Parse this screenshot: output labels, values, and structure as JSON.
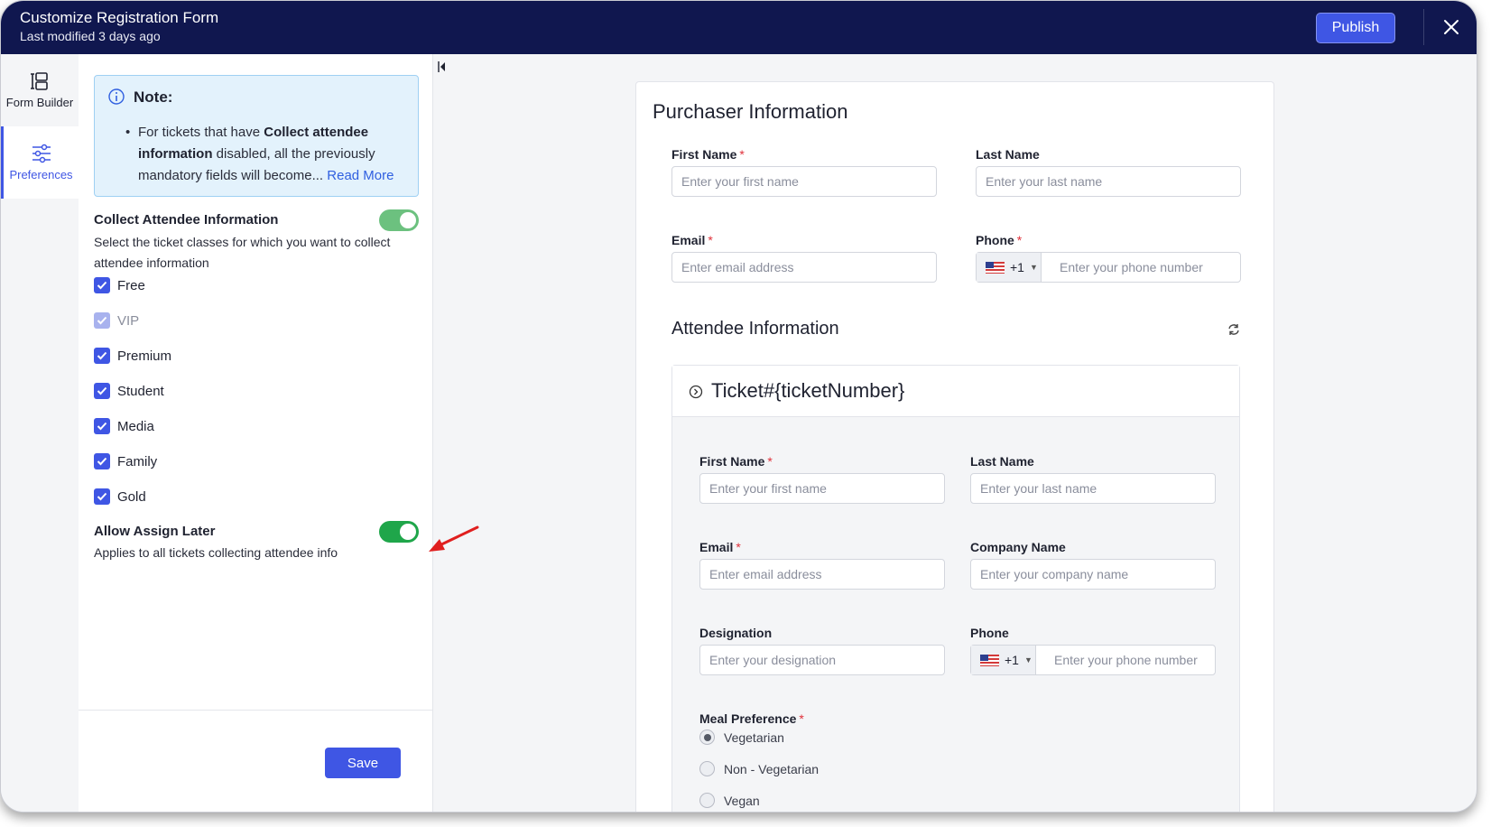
{
  "header": {
    "title": "Customize Registration Form",
    "subtitle": "Last modified 3 days ago",
    "publish_label": "Publish"
  },
  "rail": {
    "items": [
      {
        "label": "Form Builder",
        "icon": "form-builder-icon"
      },
      {
        "label": "Preferences",
        "icon": "sliders-icon",
        "active": true
      }
    ]
  },
  "note": {
    "title": "Note:",
    "text_prefix": "For tickets that have ",
    "text_bold": "Collect attendee information",
    "text_suffix": " disabled, all the previously mandatory fields will become...",
    "read_more": "Read More"
  },
  "collect_attendee": {
    "title": "Collect Attendee Information",
    "description": "Select the ticket classes for which you want to collect attendee information",
    "enabled": true,
    "ticket_classes": [
      {
        "label": "Free",
        "checked": true,
        "disabled": false
      },
      {
        "label": "VIP",
        "checked": true,
        "disabled": true
      },
      {
        "label": "Premium",
        "checked": true,
        "disabled": false
      },
      {
        "label": "Student",
        "checked": true,
        "disabled": false
      },
      {
        "label": "Media",
        "checked": true,
        "disabled": false
      },
      {
        "label": "Family",
        "checked": true,
        "disabled": false
      },
      {
        "label": "Gold",
        "checked": true,
        "disabled": false
      }
    ]
  },
  "assign_later": {
    "title": "Allow Assign Later",
    "description": "Applies to all tickets collecting attendee info",
    "enabled": true
  },
  "save_label": "Save",
  "purchaser": {
    "heading": "Purchaser Information",
    "first_name_label": "First Name",
    "first_name_placeholder": "Enter your first name",
    "last_name_label": "Last Name",
    "last_name_placeholder": "Enter your last name",
    "email_label": "Email",
    "email_placeholder": "Enter email address",
    "phone_label": "Phone",
    "phone_code": "+1",
    "phone_placeholder": "Enter your phone number"
  },
  "attendee": {
    "heading": "Attendee Information",
    "ticket_title": "Ticket#{ticketNumber}",
    "first_name_label": "First Name",
    "first_name_placeholder": "Enter your first name",
    "last_name_label": "Last Name",
    "last_name_placeholder": "Enter your last name",
    "email_label": "Email",
    "email_placeholder": "Enter email address",
    "company_label": "Company Name",
    "company_placeholder": "Enter your company name",
    "designation_label": "Designation",
    "designation_placeholder": "Enter your designation",
    "phone_label": "Phone",
    "phone_code": "+1",
    "phone_placeholder": "Enter your phone number",
    "meal_label": "Meal Preference",
    "meal_options": [
      {
        "label": "Vegetarian",
        "selected": true
      },
      {
        "label": "Non - Vegetarian",
        "selected": false
      },
      {
        "label": "Vegan",
        "selected": false
      }
    ]
  },
  "colors": {
    "header_bg": "#10174f",
    "accent": "#3f56e4",
    "toggle_on": "#1fa64a",
    "toggle_on_light": "#6cc17f",
    "required": "#e0303a",
    "annotation_arrow": "#e01f1f"
  }
}
